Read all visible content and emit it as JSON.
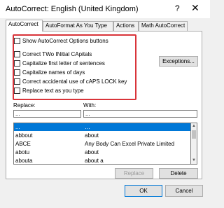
{
  "window": {
    "title": "AutoCorrect: English (United Kingdom)",
    "help_label": "?",
    "close_label": "✕"
  },
  "tabs": [
    {
      "label": "AutoCorrect",
      "active": true
    },
    {
      "label": "AutoFormat As You Type"
    },
    {
      "label": "Actions"
    },
    {
      "label": "Math AutoCorrect"
    }
  ],
  "options": {
    "show_buttons": "Show AutoCorrect Options buttons",
    "two_initial_caps": "Correct TWo INitial CApitals",
    "first_letter_sentences": "Capitalize first letter of sentences",
    "names_of_days": "Capitalize names of days",
    "caps_lock": "Correct accidental use of cAPS LOCK key",
    "replace_text": "Replace text as you type"
  },
  "exceptions_label": "Exceptions...",
  "replace": {
    "replace_label": "Replace:",
    "with_label": "With:",
    "replace_value": "...",
    "with_value": "..."
  },
  "entries": [
    {
      "replace": "...",
      "with": "…"
    },
    {
      "replace": "abbout",
      "with": "about"
    },
    {
      "replace": "ABCE",
      "with": "Any Body Can Excel Private Limited"
    },
    {
      "replace": "abotu",
      "with": "about"
    },
    {
      "replace": "abouta",
      "with": "about a"
    }
  ],
  "buttons": {
    "replace": "Replace",
    "delete": "Delete",
    "ok": "OK",
    "cancel": "Cancel"
  },
  "colors": {
    "highlight": "#d9343a",
    "selection": "#0078d7"
  }
}
